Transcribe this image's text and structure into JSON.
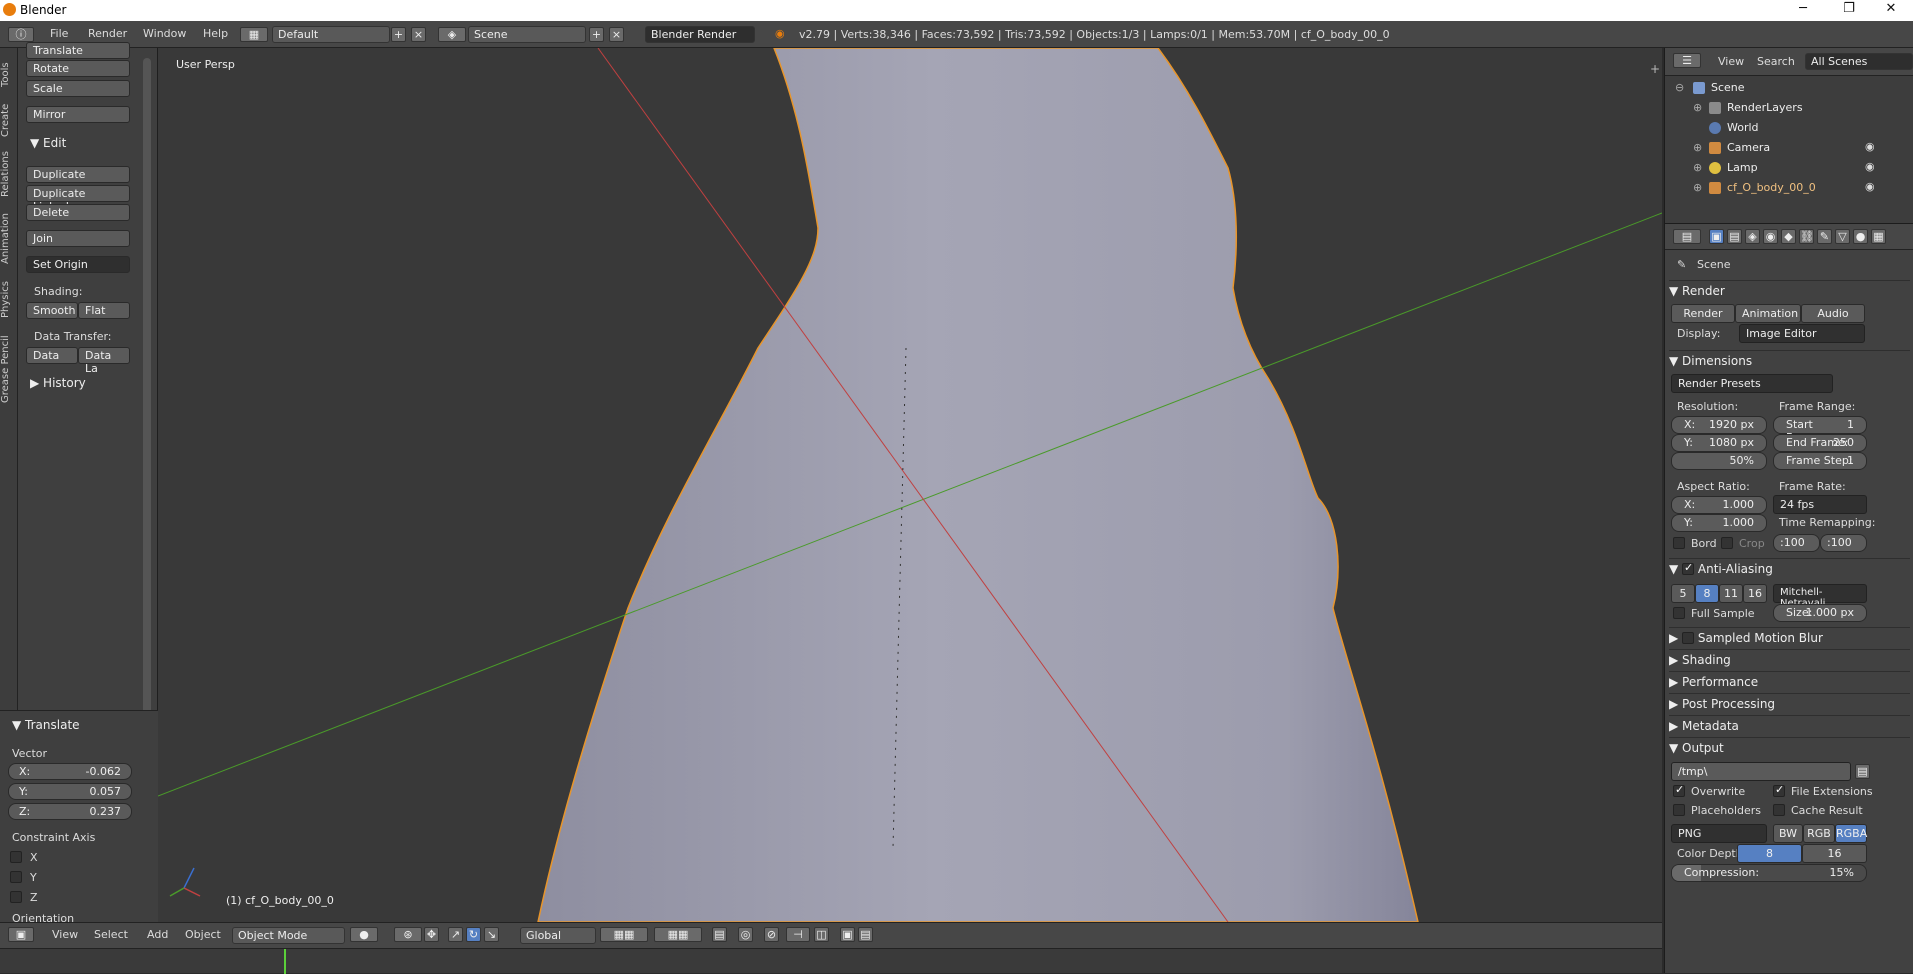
{
  "window": {
    "title": "Blender",
    "minimize": "─",
    "maximize": "❐",
    "close": "✕"
  },
  "menu": {
    "file": "File",
    "render": "Render",
    "window": "Window",
    "help": "Help",
    "layout": "Default",
    "scene": "Scene",
    "engine": "Blender Render",
    "stats": "v2.79 | Verts:38,346 | Faces:73,592 | Tris:73,592 | Objects:1/3 | Lamps:0/1 | Mem:53.70M | cf_O_body_00_0"
  },
  "lefttabs": [
    "Tools",
    "Create",
    "Relations",
    "Animation",
    "Physics",
    "Grease Pencil"
  ],
  "toolshelf": {
    "translate_cut": "Translate",
    "rotate": "Rotate",
    "scale": "Scale",
    "mirror": "Mirror",
    "edit_header": "Edit",
    "duplicate": "Duplicate",
    "duplicate_linked": "Duplicate Linked",
    "delete": "Delete",
    "join": "Join",
    "set_origin": "Set Origin",
    "shading_label": "Shading:",
    "smooth": "Smooth",
    "flat": "Flat",
    "data_transfer_label": "Data Transfer:",
    "data": "Data",
    "data_la": "Data La",
    "history": "History"
  },
  "operator": {
    "header": "Translate",
    "vector_label": "Vector",
    "x_label": "X:",
    "x": "-0.062",
    "y_label": "Y:",
    "y": "0.057",
    "z_label": "Z:",
    "z": "0.237",
    "constraint_label": "Constraint Axis",
    "cx": "X",
    "cy": "Y",
    "cz": "Z",
    "orientation": "Orientation"
  },
  "viewport": {
    "persp": "User Persp",
    "object": "(1) cf_O_body_00_0"
  },
  "viewheader": {
    "view": "View",
    "select": "Select",
    "add": "Add",
    "object": "Object",
    "mode": "Object Mode",
    "orientation": "Global"
  },
  "outliner": {
    "view": "View",
    "search": "Search",
    "filter": "All Scenes",
    "items": [
      {
        "name": "Scene",
        "indent": 0
      },
      {
        "name": "RenderLayers",
        "indent": 1
      },
      {
        "name": "World",
        "indent": 1
      },
      {
        "name": "Camera",
        "indent": 1
      },
      {
        "name": "Lamp",
        "indent": 1
      },
      {
        "name": "cf_O_body_00_0",
        "indent": 1
      }
    ]
  },
  "props": {
    "context": "Scene",
    "render_header": "Render",
    "render_btn": "Render",
    "animation_btn": "Animation",
    "audio_btn": "Audio",
    "display_label": "Display:",
    "display": "Image Editor",
    "dimensions": "Dimensions",
    "presets": "Render Presets",
    "resolution": "Resolution:",
    "res_x_label": "X:",
    "res_x": "1920 px",
    "res_y_label": "Y:",
    "res_y": "1080 px",
    "res_pct": "50%",
    "frame_range": "Frame Range:",
    "start_label": "Start Frame:",
    "start": "1",
    "end_label": "End Frame:",
    "end": "250",
    "step_label": "Frame Step:",
    "step": "1",
    "aspect": "Aspect Ratio:",
    "asp_x": "1.000",
    "asp_y": "1.000",
    "frame_rate": "Frame Rate:",
    "fps": "24 fps",
    "time_remap": "Time Remapping:",
    "remap_old": ":100",
    "remap_new": ":100",
    "bord": "Bord",
    "crop": "Crop",
    "aa": "Anti-Aliasing",
    "aa5": "5",
    "aa8": "8",
    "aa11": "11",
    "aa16": "16",
    "filter": "Mitchell-Netravali",
    "full_sample": "Full Sample",
    "size_label": "Size:",
    "size": "1.000 px",
    "motion_blur": "Sampled Motion Blur",
    "shading": "Shading",
    "performance": "Performance",
    "post": "Post Processing",
    "metadata": "Metadata",
    "output": "Output",
    "path": "/tmp\\",
    "overwrite": "Overwrite",
    "file_ext": "File Extensions",
    "placeholders": "Placeholders",
    "cache": "Cache Result",
    "format": "PNG",
    "bw": "BW",
    "rgb": "RGB",
    "rgba": "RGBA",
    "color_depth_label": "Color Depth:",
    "depth8": "8",
    "depth16": "16",
    "compression_label": "Compression:",
    "compression": "15%"
  }
}
